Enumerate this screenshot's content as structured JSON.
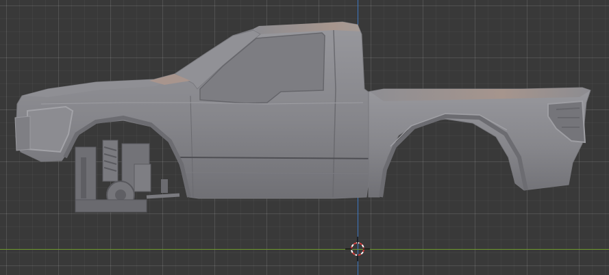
{
  "viewport": {
    "background_color": "#393939",
    "grid_color": "#474747",
    "axis_colors": {
      "x_axis": "#6f9a2c",
      "z_axis": "#3d78c2"
    }
  },
  "model": {
    "body_color": "#8a8a8f",
    "shade_color": "#6f6f74",
    "highlight_color": "#b9a49a",
    "chassis_color": "#737378"
  },
  "cursor": {
    "ring_colors": [
      "#d23b3b",
      "#ffffff"
    ],
    "icon": "3d-cursor-icon"
  }
}
